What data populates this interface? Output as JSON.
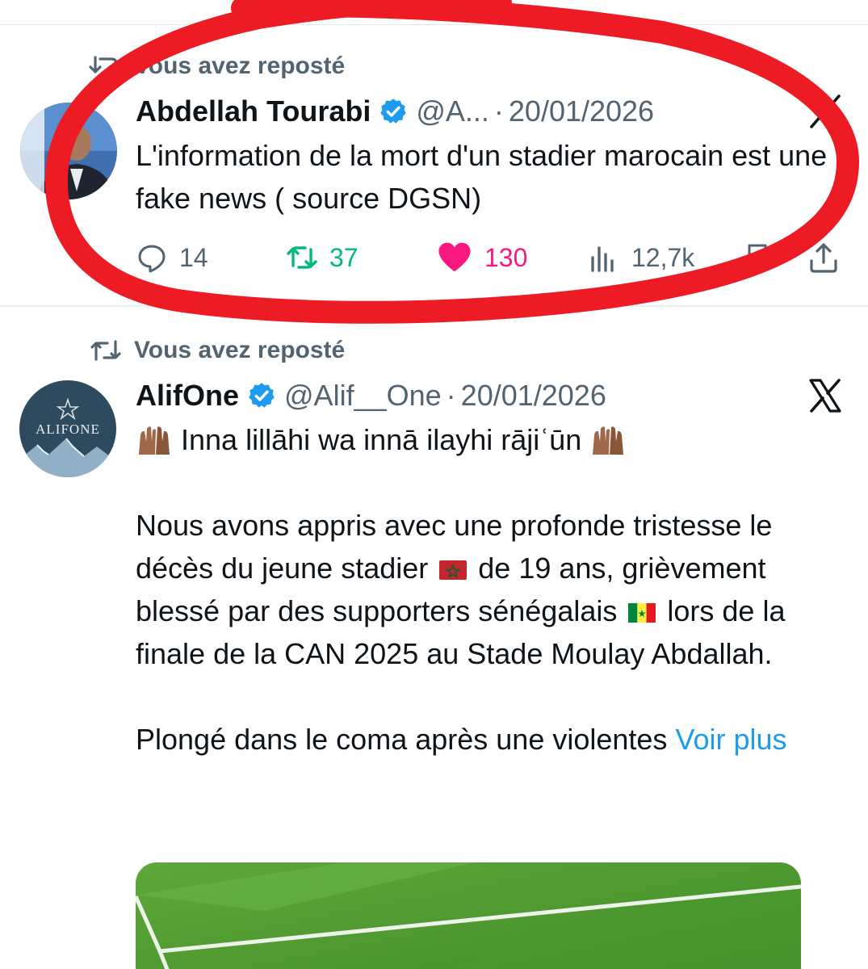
{
  "tweets": [
    {
      "repost_label": "Vous avez reposté",
      "author_name": "Abdellah Tourabi",
      "author_handle": "@A...",
      "separator": "·",
      "date": "20/01/2026",
      "text": "L'information de la mort d'un stadier marocain est une fake news ( source DGSN)",
      "counts": {
        "replies": "14",
        "reposts": "37",
        "likes": "130",
        "views": "12,7k"
      }
    },
    {
      "repost_label": "Vous avez reposté",
      "author_name": "AlifOne",
      "author_handle": "@Alif__One",
      "separator": "·",
      "date": "20/01/2026",
      "avatar_text": "ALIFONE",
      "text_line1": "Inna lillāhi wa innā ilayhi rājiʿūn",
      "p2_before_flag": "Nous avons appris avec une profonde tristesse le décès du jeune stadier",
      "p2_after_flag": "de 19 ans, grièvement blessé par des supporters sénégalais",
      "p2_after_flag2": "lors de la finale de la CAN 2025 au Stade Moulay Abdallah.",
      "p3_text": "Plongé dans le coma après une violentes",
      "more_link": "Voir plus"
    }
  ],
  "icons": {
    "repost": "repost-icon",
    "verified": "verified-badge-icon",
    "close": "x-logo-icon",
    "reply": "reply-icon",
    "like": "heart-filled-icon",
    "views": "views-bar-chart-icon",
    "share": "share-icon",
    "bookmark": "bookmark-icon"
  },
  "colors": {
    "text": "#0f1419",
    "muted": "#536471",
    "link": "#1d9bf0",
    "verified": "#1d9bf0",
    "repost_active": "#00ba7c",
    "like_active": "#f91880",
    "annotation_stroke": "#ec1b24"
  }
}
